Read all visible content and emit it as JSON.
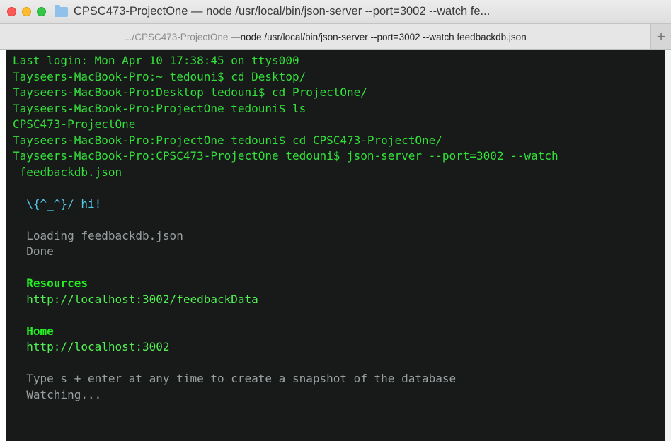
{
  "window": {
    "title": "CPSC473-ProjectOne — node /usr/local/bin/json-server --port=3002 --watch fe..."
  },
  "tab": {
    "path": ".../CPSC473-ProjectOne — ",
    "label": "node /usr/local/bin/json-server --port=3002 --watch feedbackdb.json",
    "new_tab": "+"
  },
  "terminal": {
    "last_login": "Last login: Mon Apr 10 17:38:45 on ttys000",
    "commands": [
      "Tayseers-MacBook-Pro:~ tedouni$ cd Desktop/",
      "Tayseers-MacBook-Pro:Desktop tedouni$ cd ProjectOne/",
      "Tayseers-MacBook-Pro:ProjectOne tedouni$ ls"
    ],
    "ls_output": "CPSC473-ProjectOne",
    "cd_cmd": "Tayseers-MacBook-Pro:ProjectOne tedouni$ cd CPSC473-ProjectOne/",
    "server_cmd": "Tayseers-MacBook-Pro:CPSC473-ProjectOne tedouni$ json-server --port=3002 --watch",
    "server_cmd_cont": " feedbackdb.json",
    "greeting": "  \\{^_^}/ hi!",
    "loading": "  Loading feedbackdb.json",
    "done": "  Done",
    "resources_label": "  Resources",
    "resources_url": "  http://localhost:3002/feedbackData",
    "home_label": "  Home",
    "home_url": "  http://localhost:3002",
    "snapshot_hint": "  Type s + enter at any time to create a snapshot of the database",
    "watching": "  Watching..."
  }
}
